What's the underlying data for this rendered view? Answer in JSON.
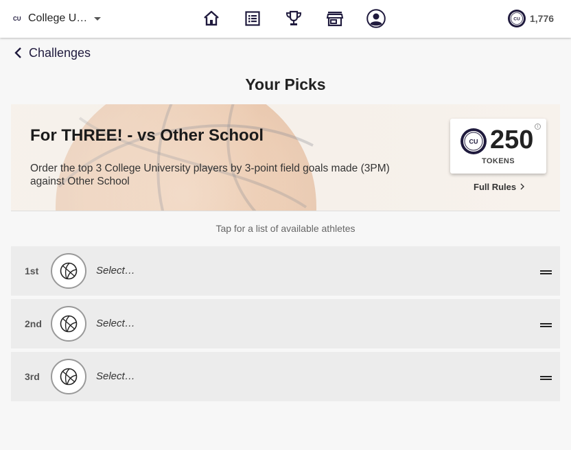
{
  "header": {
    "school_name": "College U…",
    "nav": [
      {
        "icon": "home-icon"
      },
      {
        "icon": "list-icon"
      },
      {
        "icon": "trophy-icon"
      },
      {
        "icon": "store-icon"
      },
      {
        "icon": "profile-icon"
      }
    ],
    "token_balance": "1,776",
    "logo_text": "CU"
  },
  "back": {
    "label": "Challenges"
  },
  "page": {
    "title": "Your Picks"
  },
  "challenge": {
    "title": "For THREE! - vs Other School",
    "description": "Order the top 3 College University players by 3-point field goals made (3PM) against Other School",
    "reward_value": "250",
    "reward_unit": "TOKENS",
    "info_symbol": "i",
    "rules_label": "Full Rules"
  },
  "hint": "Tap for a list of available athletes",
  "picks": [
    {
      "rank": "1st",
      "placeholder": "Select…"
    },
    {
      "rank": "2nd",
      "placeholder": "Select…"
    },
    {
      "rank": "3rd",
      "placeholder": "Select…"
    }
  ],
  "colors": {
    "brand_navy": "#1f1a3d",
    "row_background": "#ececec",
    "page_background": "#f7f7f7"
  }
}
